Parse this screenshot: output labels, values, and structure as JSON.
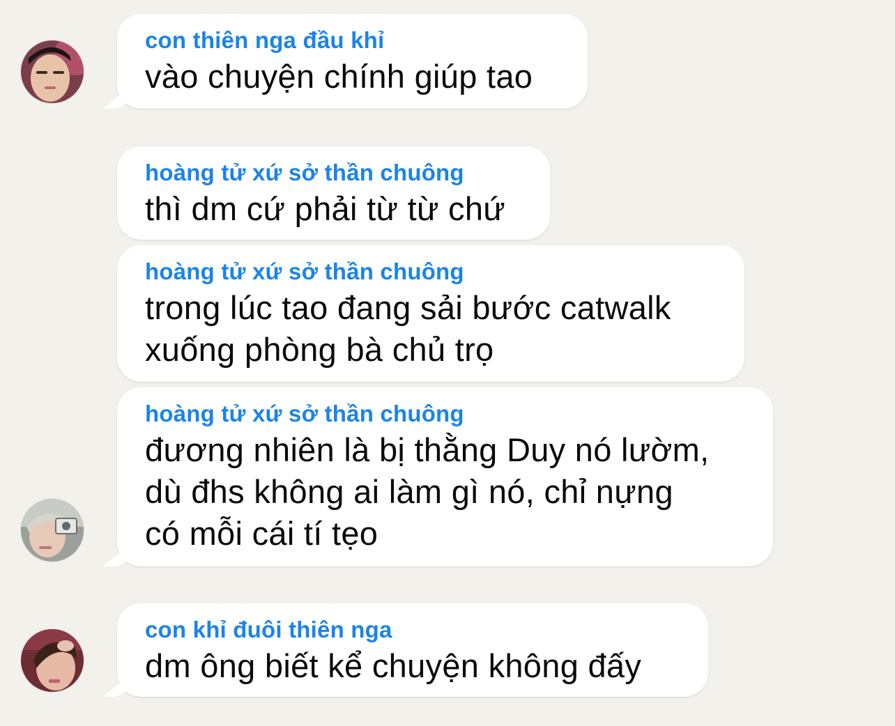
{
  "messages": [
    {
      "sender": "con thiên nga đầu khỉ",
      "text": "vào chuyện chính giúp tao"
    },
    {
      "sender": "hoàng tử xứ sở thần chuông",
      "text": "thì dm cứ phải từ từ chứ"
    },
    {
      "sender": "hoàng tử xứ sở thần chuông",
      "text": "trong lúc tao đang sải bước catwalk\nxuống phòng bà chủ trọ"
    },
    {
      "sender": "hoàng tử xứ sở thần chuông",
      "text": "đương nhiên là bị thằng Duy nó lườm,\ndù đhs không ai làm gì nó, chỉ nựng\ncó mỗi cái tí tẹo"
    },
    {
      "sender": "con khỉ đuôi thiên nga",
      "text": "dm ông biết kể chuyện không đấy"
    }
  ],
  "colors": {
    "background": "#f3f1ec",
    "bubble": "#ffffff",
    "sender_name": "#1b84e8",
    "message_text": "#0a0a0a"
  }
}
